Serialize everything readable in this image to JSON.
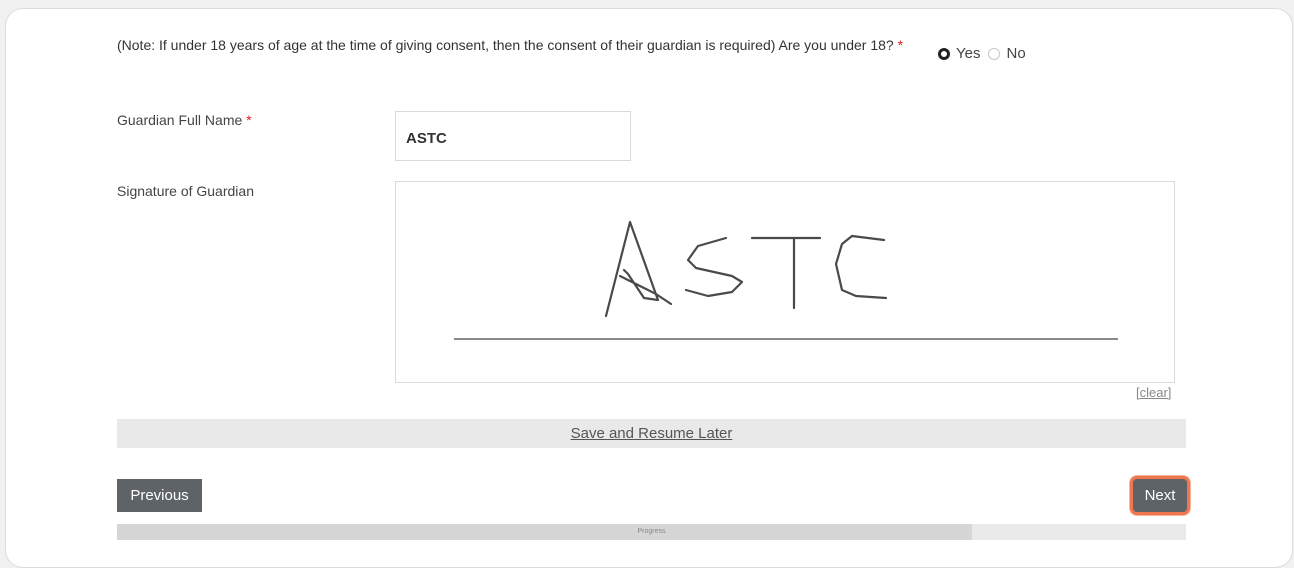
{
  "question": {
    "text": "(Note: If under 18 years of age at the time of giving consent, then the consent of their guardian is required) Are you under 18?",
    "required_mark": "*",
    "options": [
      {
        "label": "Yes",
        "selected": true
      },
      {
        "label": "No",
        "selected": false
      }
    ]
  },
  "guardian_name": {
    "label": "Guardian Full Name",
    "required_mark": "*",
    "value": "ASTC"
  },
  "signature": {
    "label": "Signature of Guardian",
    "drawn_text": "ASTC",
    "clear_label": "[clear]"
  },
  "save_resume_label": "Save and Resume Later",
  "buttons": {
    "previous": "Previous",
    "next": "Next"
  },
  "progress": {
    "label": "Progress",
    "fraction": 0.8
  },
  "colors": {
    "button_bg": "#5e6368",
    "required": "#e02020",
    "focus_ring": "#f0764f"
  }
}
